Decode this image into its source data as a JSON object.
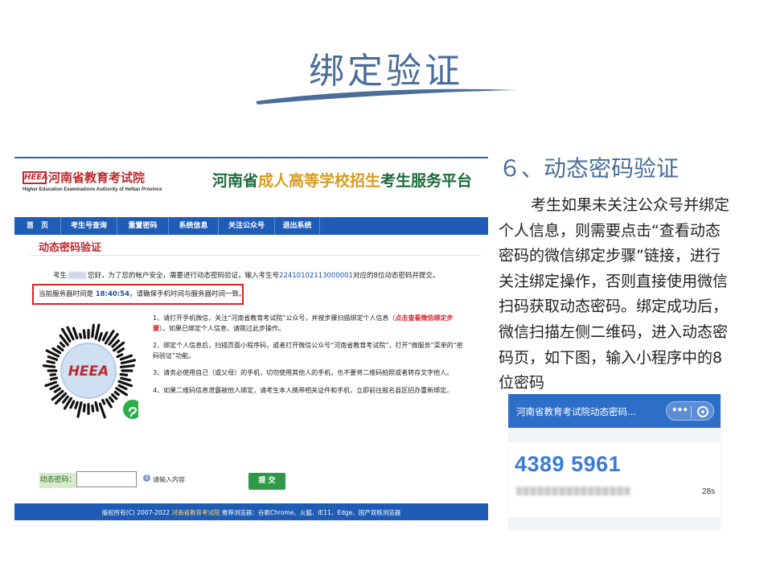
{
  "slide": {
    "title": "绑定验证",
    "step_title": "６、动态密码验证",
    "body_text": "考生如果未关注公众号并绑定个人信息，则需要点击“查看动态密码的微信绑定步骤”链接，进行关注绑定操作，否则直接使用微信扫码获取动态密码。绑定成功后，微信扫描左侧二维码，进入动态密码页，如下图，输入小程序中的8位密码"
  },
  "site": {
    "logo_mark": "HEEA",
    "name": "河南省教育考试院",
    "name_en": "Higher Education Examinations Authority of HeNan Province",
    "platform_prefix": "河南省",
    "platform_highlight": "成人高等学校招生",
    "platform_suffix": "考生服务平台",
    "nav": [
      {
        "label": "首　页"
      },
      {
        "label": "考生号查询"
      },
      {
        "label": "重置密码"
      },
      {
        "label": "系统信息"
      },
      {
        "label": "关注公众号"
      },
      {
        "label": "退出系统"
      }
    ],
    "page_heading": "动态密码验证",
    "notice": {
      "prefix": "考生",
      "middle": "您好，为了您的帐户安全，需要进行动态密码验证，输入考生号",
      "exam_number": "22410102113000001",
      "suffix": "对应的8位动态密码并提交。"
    },
    "server_time": {
      "prefix": "当前服务器时间是",
      "time": "18:40:54",
      "suffix": "，请确保手机时间与服务器时间一致。"
    },
    "qr_logo": "HEEA",
    "instructions": {
      "item1_prefix": "1、请打开手机微信，关注“河南省教育考试院”公众号，并按步骤扫描绑定个人信息（",
      "item1_link": "点击查看微信绑定步骤",
      "item1_suffix": "）。如果已绑定个人信息，请跳过此步操作。",
      "item2": "2、绑定个人信息后，扫描页面小程序码，或者打开微信公众号“河南省教育考试院”，打开“微服务”菜单的“密码验证”功能。",
      "item3": "3、请务必使用自己（或父母）的手机，切勿使用其他人的手机，也不要将二维码拍照或者转存文字他人。",
      "item4": "4、如果二维码信息泄露被他人绑定，请考生本人携带相关证件和手机，立即前往报名县区招办重新绑定。"
    },
    "code_label": "动态密码：",
    "code_value": "",
    "info_glyph": "i",
    "hint": "请输入内容",
    "submit_label": "提 交",
    "footer": {
      "prefix": "版权所有(C) 2007-2022",
      "link": "河南省教育考试院",
      "suffix": "推荐浏览器：谷歌Chrome、火狐、IE11、Edge、国产双核浏览器"
    }
  },
  "phone": {
    "title": "河南省教育考试院动态密码...",
    "code": "4389 5961",
    "timer": "28s",
    "capsule_dots": "•••"
  },
  "colors": {
    "title_blue": "#4a6d9a",
    "nav_blue": "#1f5cb6",
    "brand_red": "#c0282d",
    "platform_green": "#1b6b3a",
    "platform_gold": "#d99a1e",
    "submit_green": "#2e9a47",
    "phone_bar": "#2d6fc8",
    "phone_code": "#3a7bd5"
  },
  "icons": [
    "info-icon",
    "more-dots-icon",
    "close-ring-icon",
    "wechat-mini-program-icon"
  ]
}
